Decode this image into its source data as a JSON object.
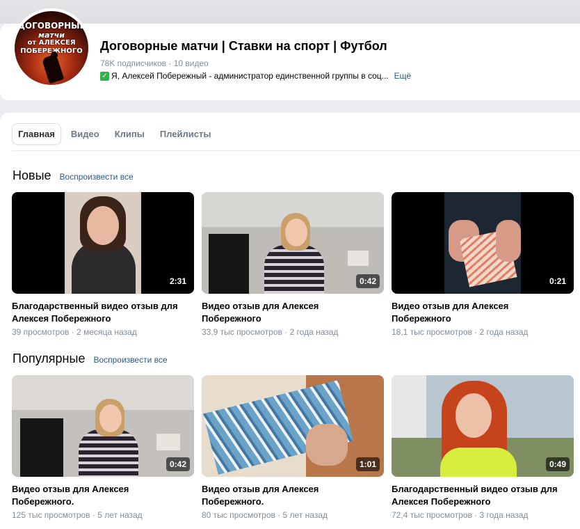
{
  "channel": {
    "title": "Договорные матчи | Ставки на спорт | Футбол",
    "subscribers": "78K подписчиков",
    "separator": "·",
    "video_count": "10 видео",
    "description": "Я, Алексей Побережный - администратор единственной группы в соц...",
    "more_label": "Ещё",
    "avatar_text": {
      "line1": "ДОГОВОРНЫЕ",
      "line2": "матчи",
      "line3": "от АЛЕКСЕЯ",
      "line4": "ПОБЕРЕЖНОГО"
    }
  },
  "tabs": [
    {
      "label": "Главная",
      "active": true
    },
    {
      "label": "Видео",
      "active": false
    },
    {
      "label": "Клипы",
      "active": false
    },
    {
      "label": "Плейлисты",
      "active": false
    }
  ],
  "sections": {
    "new": {
      "title": "Новые",
      "play_all": "Воспроизвести все",
      "videos": [
        {
          "title": "Благодарственный видео отзыв для Алексея Побережного",
          "views": "39 просмотров",
          "age": "2 месяца назад",
          "duration": "2:31"
        },
        {
          "title": "Видео отзыв для Алексея Побережного",
          "views": "33,9 тыс просмотров",
          "age": "2 года назад",
          "duration": "0:42"
        },
        {
          "title": "Видео отзыв для Алексея Побережного",
          "views": "18,1 тыс просмотров",
          "age": "2 года назад",
          "duration": "0:21"
        }
      ]
    },
    "popular": {
      "title": "Популярные",
      "play_all": "Воспроизвести все",
      "videos": [
        {
          "title": "Видео отзыв для Алексея Побережного.",
          "views": "125 тыс просмотров",
          "age": "5 лет назад",
          "duration": "0:42"
        },
        {
          "title": "Видео отзыв для Алексея Побережного.",
          "views": "80 тыс просмотров",
          "age": "5 лет назад",
          "duration": "1:01"
        },
        {
          "title": "Благодарственный видео отзыв для Алексея Побережного",
          "views": "72,4 тыс просмотров",
          "age": "3 года назад",
          "duration": "0:49"
        }
      ]
    }
  },
  "colors": {
    "link": "#2a5885",
    "muted": "#818c99",
    "check_badge": "#2fb34a"
  }
}
